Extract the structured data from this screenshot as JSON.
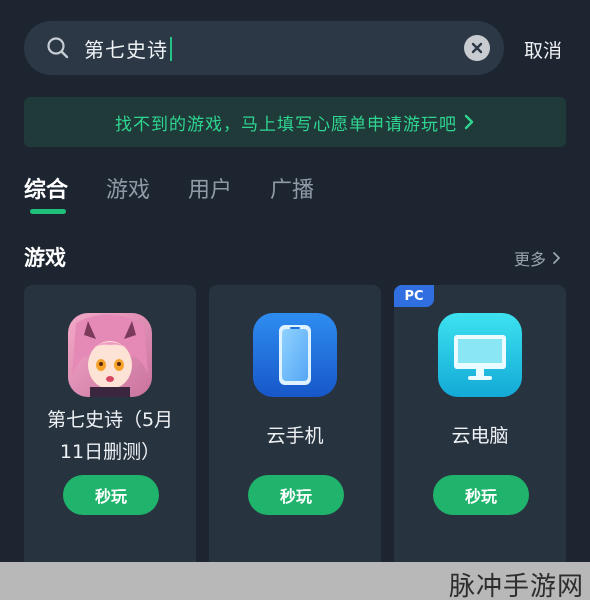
{
  "search": {
    "query": "第七史诗",
    "cancel_label": "取消"
  },
  "wish_banner": {
    "text": "找不到的游戏，马上填写心愿单申请游玩吧"
  },
  "tabs": [
    {
      "label": "综合",
      "active": true
    },
    {
      "label": "游戏",
      "active": false
    },
    {
      "label": "用户",
      "active": false
    },
    {
      "label": "广播",
      "active": false
    }
  ],
  "section": {
    "title": "游戏",
    "more_label": "更多"
  },
  "cards": [
    {
      "name_line1": "第七史诗（5月",
      "name_line2": "11日删测）",
      "button": "秒玩",
      "icon": "game-character-icon"
    },
    {
      "name": "云手机",
      "button": "秒玩",
      "icon": "cloud-phone-icon"
    },
    {
      "name": "云电脑",
      "button": "秒玩",
      "icon": "cloud-pc-icon",
      "badge": "PC"
    }
  ],
  "watermark": "脉冲手游网",
  "colors": {
    "accent": "#1fb36c",
    "background": "#1c2530",
    "card": "#283340",
    "badge": "#2f6fe0"
  }
}
